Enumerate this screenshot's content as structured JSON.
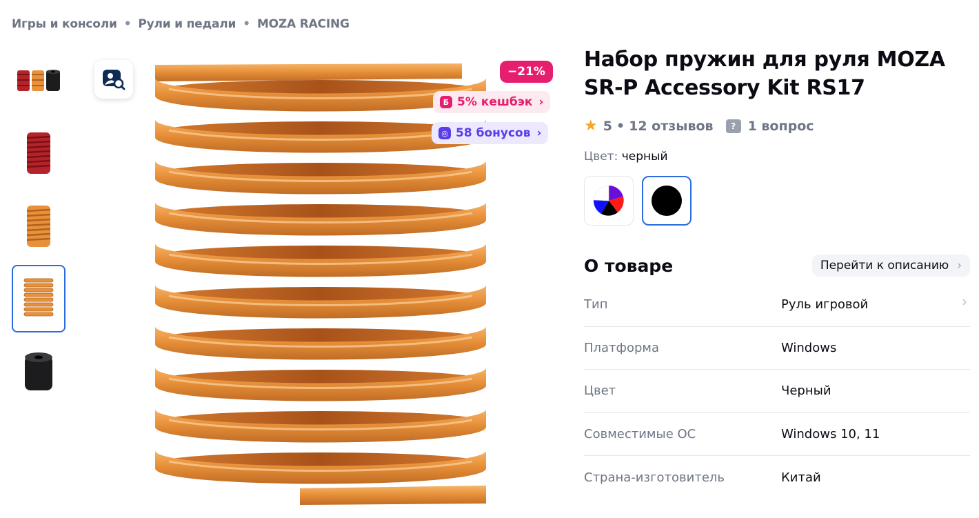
{
  "breadcrumb": {
    "items": [
      "Игры и консоли",
      "Рули и педали",
      "MOZA RACING"
    ],
    "separator": "•"
  },
  "thumbnails": [
    {
      "name": "thumb-springs-set",
      "active": false
    },
    {
      "name": "thumb-red-spring",
      "active": false
    },
    {
      "name": "thumb-orange-spring",
      "active": false
    },
    {
      "name": "thumb-orange-spring-tall",
      "active": true
    },
    {
      "name": "thumb-black-bushing",
      "active": false
    }
  ],
  "gallery": {
    "discount": "−21%",
    "cashback": {
      "icon_letter": "Б",
      "label": "5% кешбэк"
    },
    "bonus": {
      "label": "58 бонусов"
    },
    "search_icon": "image-search-icon"
  },
  "product": {
    "title": "Набор пружин для руля MOZA SR-P Accessory Kit RS17",
    "rating": "5",
    "reviews": "12 отзывов",
    "rating_sep": "•",
    "questions": "1 вопрос",
    "color_label": "Цвет:",
    "color_value": "черный",
    "swatches": [
      {
        "name": "multicolor",
        "active": false
      },
      {
        "name": "black",
        "active": true
      }
    ]
  },
  "about": {
    "title": "О товаре",
    "goto_label": "Перейти к описанию",
    "specs": [
      {
        "key": "Тип",
        "value": "Руль игровой"
      },
      {
        "key": "Платформа",
        "value": "Windows"
      },
      {
        "key": "Цвет",
        "value": "Черный"
      },
      {
        "key": "Совместимые ОС",
        "value": "Windows 10, 11"
      },
      {
        "key": "Страна-изготовитель",
        "value": "Китай"
      }
    ]
  },
  "colors": {
    "accent_blue": "#2a6ce0",
    "discount_pink": "#e61e6e",
    "bonus_purple": "#5a3ee8",
    "spring_orange": "#e8913a",
    "star": "#f5a623"
  }
}
